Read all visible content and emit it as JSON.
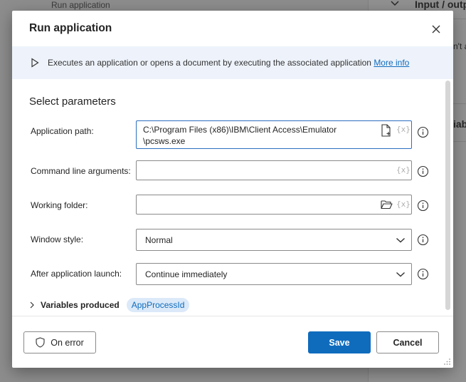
{
  "background": {
    "behind_title": "Run application",
    "right_panel": {
      "header": "Input / outp",
      "item_1": "n't a",
      "item_2": "iab"
    }
  },
  "dialog": {
    "title": "Run application",
    "close_icon": "close-icon",
    "description": "Executes an application or opens a document by executing the associated application",
    "more_info": "More info",
    "section_title": "Select parameters",
    "fields": {
      "application_path": {
        "label": "Application path:",
        "value_line1": "C:\\Program Files (x86)\\IBM\\Client Access\\Emulator",
        "value_line2": "\\pcsws.exe",
        "var_token": "{x}"
      },
      "command_line_arguments": {
        "label": "Command line arguments:",
        "value": "",
        "var_token": "{x}"
      },
      "working_folder": {
        "label": "Working folder:",
        "value": "",
        "var_token": "{x}"
      },
      "window_style": {
        "label": "Window style:",
        "selected": "Normal"
      },
      "after_application_launch": {
        "label": "After application launch:",
        "selected": "Continue immediately"
      }
    },
    "variables_produced": {
      "label": "Variables produced",
      "chip": "AppProcessId"
    },
    "buttons": {
      "on_error": "On error",
      "save": "Save",
      "cancel": "Cancel"
    }
  },
  "colors": {
    "accent": "#0f6cbd",
    "info_bar": "#eef3fb",
    "chip_bg": "#dbe9f9"
  }
}
